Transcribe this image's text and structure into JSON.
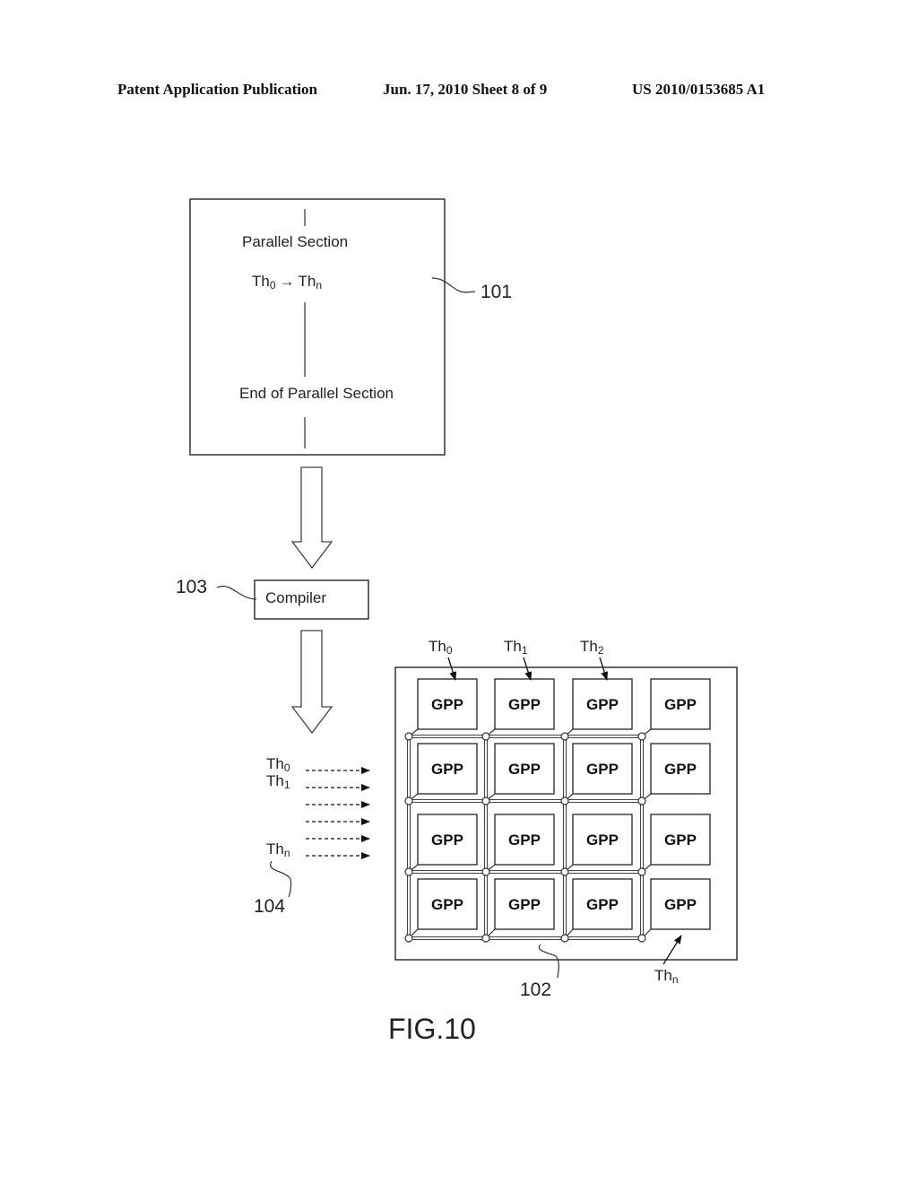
{
  "header": {
    "left": "Patent Application Publication",
    "middle": "Jun. 17, 2010  Sheet 8 of 9",
    "right": "US 2010/0153685 A1"
  },
  "source_block": {
    "ref": "101",
    "title": "Parallel Section",
    "thread_base": "Th",
    "thread_from_sub": "0",
    "arrow": "→",
    "thread_to_sub": "n",
    "end_label": "End of Parallel Section"
  },
  "compiler": {
    "ref": "103",
    "label": "Compiler"
  },
  "threads": {
    "ref": "104",
    "base": "Th",
    "labels": [
      {
        "sub": "0"
      },
      {
        "sub": "1"
      },
      {
        "sub": ""
      },
      {
        "sub": ""
      },
      {
        "sub": ""
      },
      {
        "sub": "n"
      }
    ]
  },
  "processor_array": {
    "ref": "102",
    "cell_label": "GPP",
    "rows": 4,
    "cols": 4,
    "top_thread_labels": [
      {
        "base": "Th",
        "sub": "0"
      },
      {
        "base": "Th",
        "sub": "1"
      },
      {
        "base": "Th",
        "sub": "2"
      }
    ],
    "bottom_thread_label": {
      "base": "Th",
      "sub": "n"
    }
  },
  "figure_caption": "FIG.10"
}
